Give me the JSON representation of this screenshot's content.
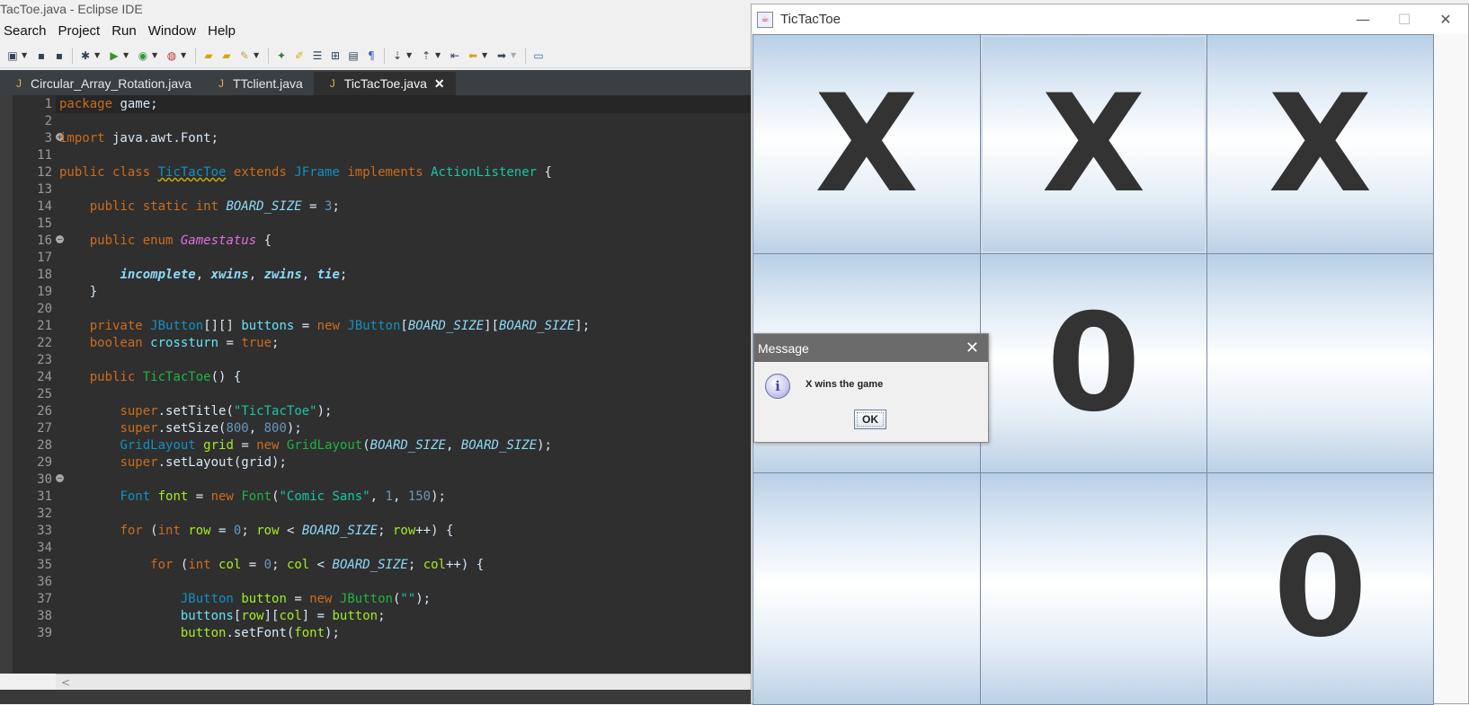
{
  "eclipse": {
    "title": "TacToe.java - Eclipse IDE",
    "menu": [
      "Search",
      "Project",
      "Run",
      "Window",
      "Help"
    ],
    "tabs": [
      {
        "label": "Circular_Array_Rotation.java",
        "active": false
      },
      {
        "label": "TTclient.java",
        "active": false
      },
      {
        "label": "TicTacToe.java",
        "active": true
      }
    ],
    "line_numbers": [
      "1",
      "2",
      "3",
      "11",
      "12",
      "13",
      "14",
      "15",
      "16",
      "17",
      "18",
      "19",
      "20",
      "21",
      "22",
      "23",
      "24",
      "25",
      "26",
      "27",
      "28",
      "29",
      "30",
      "31",
      "32",
      "33",
      "34",
      "35",
      "36",
      "37",
      "38",
      "39"
    ],
    "scroll_left_glyph": "<"
  },
  "tictactoe": {
    "title": "TicTacToe",
    "cells": [
      "X",
      "X",
      "X",
      "",
      "0",
      "",
      "",
      "",
      "0"
    ]
  },
  "dialog": {
    "title": "Message",
    "message": "X wins the game",
    "ok_label": "OK",
    "icon": "info-icon"
  }
}
